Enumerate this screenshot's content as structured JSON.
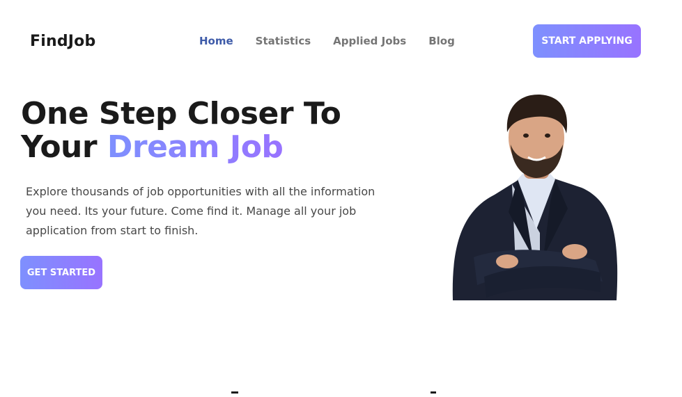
{
  "header": {
    "logo": "FindJob",
    "nav": [
      {
        "label": "Home",
        "active": true
      },
      {
        "label": "Statistics",
        "active": false
      },
      {
        "label": "Applied Jobs",
        "active": false
      },
      {
        "label": "Blog",
        "active": false
      }
    ],
    "cta_label": "START APPLYING"
  },
  "hero": {
    "title_line1": "One Step Closer To",
    "title_line2_plain": "Your",
    "title_line2_accent": "Dream Job",
    "description": "Explore thousands of job opportunities with all the information you need. Its your future. Come find it. Manage all your job application from start to finish.",
    "cta_label": "GET STARTED",
    "image_icon": "man-portrait-image"
  },
  "colors": {
    "accent_start": "#7e90fe",
    "accent_end": "#9873ff",
    "nav_active": "#3e5ba9",
    "nav_inactive": "#757575",
    "heading": "#1a1a1a",
    "body_text": "#474747"
  }
}
